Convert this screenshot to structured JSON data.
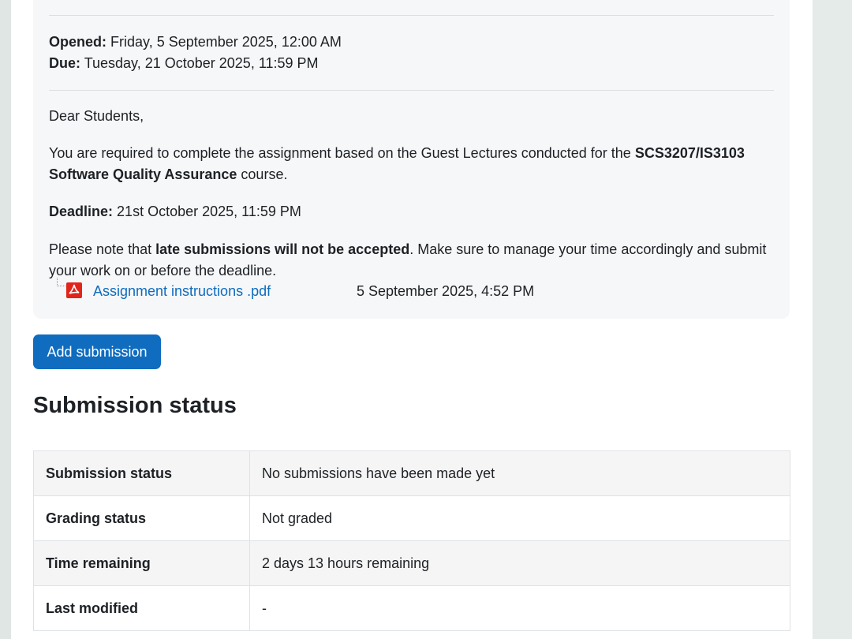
{
  "dates": {
    "opened_label": "Opened:",
    "opened_value": "Friday, 5 September 2025, 12:00 AM",
    "due_label": "Due:",
    "due_value": "Tuesday, 21 October 2025, 11:59 PM"
  },
  "intro": {
    "greeting": "Dear Students,",
    "required_prefix": "You are required to complete the assignment based on the Guest Lectures conducted for the ",
    "course_name": "SCS3207/IS3103 Software Quality Assurance",
    "required_suffix": " course.",
    "deadline_label": "Deadline:",
    "deadline_value": "21st October 2025, 11:59 PM",
    "late_prefix": "Please note that ",
    "late_bold": "late submissions will not be accepted",
    "late_suffix": ". Make sure to manage your time accordingly and submit your work on or before the deadline."
  },
  "attachment": {
    "name": "Assignment instructions .pdf",
    "date": "5 September 2025, 4:52 PM",
    "icon": "pdf-icon"
  },
  "actions": {
    "add_submission": "Add submission"
  },
  "submission": {
    "heading": "Submission status",
    "rows": [
      {
        "label": "Submission status",
        "value": "No submissions have been made yet"
      },
      {
        "label": "Grading status",
        "value": "Not graded"
      },
      {
        "label": "Time remaining",
        "value": "2 days 13 hours remaining"
      },
      {
        "label": "Last modified",
        "value": "-"
      }
    ]
  },
  "colors": {
    "primary": "#0f6cbf",
    "pdf_red": "#e1251b",
    "text": "#1d2125"
  }
}
